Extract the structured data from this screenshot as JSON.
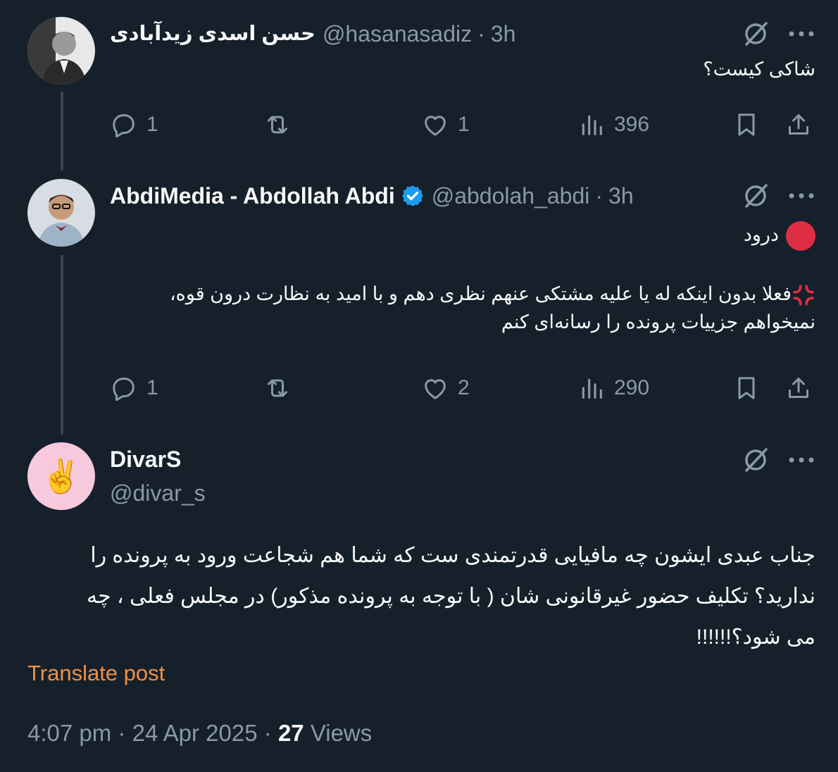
{
  "posts": [
    {
      "name": "حسن اسدی زیدآبادی",
      "handle": "@hasanasadiz",
      "separator": "·",
      "time": "3h",
      "text": "شاکی کیست؟",
      "replies": "1",
      "reposts": "",
      "likes": "1",
      "views": "396"
    },
    {
      "name": "AbdiMedia - Abdollah Abdi",
      "verified": true,
      "handle": "@abdolah_abdi",
      "separator": "·",
      "time": "3h",
      "line1": "درود",
      "line2": "فعلا بدون اینکه له یا علیه مشتکی عنهم نظری دهم و با امید به نظارت درون قوه،",
      "line3": "نمیخواهم جزییات پرونده را رسانه‌ای کنم",
      "replies": "1",
      "reposts": "",
      "likes": "2",
      "views": "290"
    },
    {
      "name": "DivarS",
      "handle": "@divar_s",
      "avatar_emoji": "✌️",
      "line1": "جناب عبدی ایشون چه مافیایی  قدرتمندی ست که شما هم شجاعت ورود به پرونده را",
      "line2": "ندارید؟ تکلیف حضور  غیرقانونی شان ( با توجه به پرونده مذکور) در مجلس فعلی ، چه",
      "line3": "می شود؟!!!!!!"
    }
  ],
  "translate_label": "Translate post",
  "timestamp": {
    "time": "4:07 pm",
    "date": "24 Apr 2025",
    "separator": "·",
    "views_count": "27",
    "views_label": "Views"
  },
  "colors": {
    "background": "#15202b",
    "text": "#f7f9f9",
    "muted": "#8b98a5",
    "accent": "#f18f44",
    "verified": "#1d9bf0",
    "thread_line": "#38444d"
  },
  "icons": [
    "grok-icon",
    "more-icon",
    "reply-icon",
    "repost-icon",
    "like-icon",
    "views-icon",
    "bookmark-icon",
    "share-icon",
    "verified-icon"
  ]
}
